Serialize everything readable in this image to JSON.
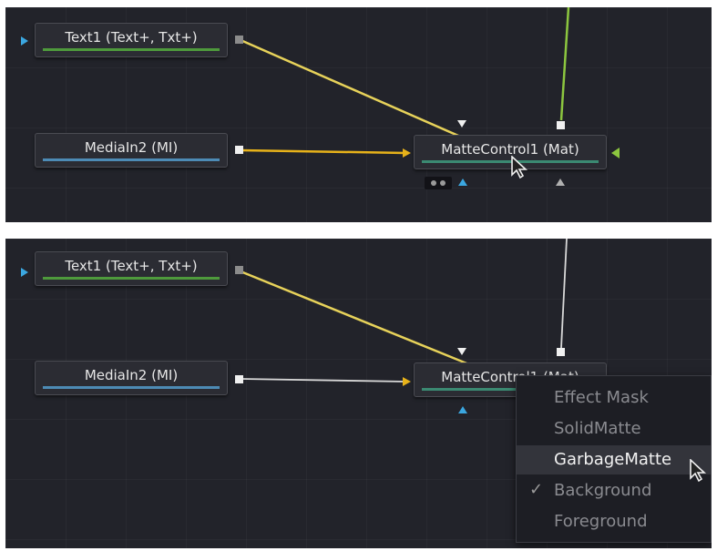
{
  "panels": [
    {
      "nodes": {
        "text1": "Text1  (Text+, Txt+)",
        "mediain2": "MediaIn2  (MI)",
        "mattecontrol1": "MatteControl1  (Mat)"
      }
    },
    {
      "nodes": {
        "text1": "Text1  (Text+, Txt+)",
        "mediain2": "MediaIn2  (MI)",
        "mattecontrol1": "MatteControl1  (Mat)"
      },
      "context_menu": {
        "items": [
          {
            "label": "Effect Mask",
            "checked": false,
            "highlighted": false
          },
          {
            "label": "SolidMatte",
            "checked": false,
            "highlighted": false
          },
          {
            "label": "GarbageMatte",
            "checked": false,
            "highlighted": true
          },
          {
            "label": "Background",
            "checked": true,
            "highlighted": false
          },
          {
            "label": "Foreground",
            "checked": false,
            "highlighted": false
          }
        ],
        "check_glyph": "✓"
      }
    }
  ],
  "colors": {
    "panel_bg": "#22232a",
    "wire_yellow": "#e7d25a",
    "wire_green": "#8cc63f",
    "wire_white": "#d8d8d8",
    "input_blue": "#3ba7e0"
  }
}
